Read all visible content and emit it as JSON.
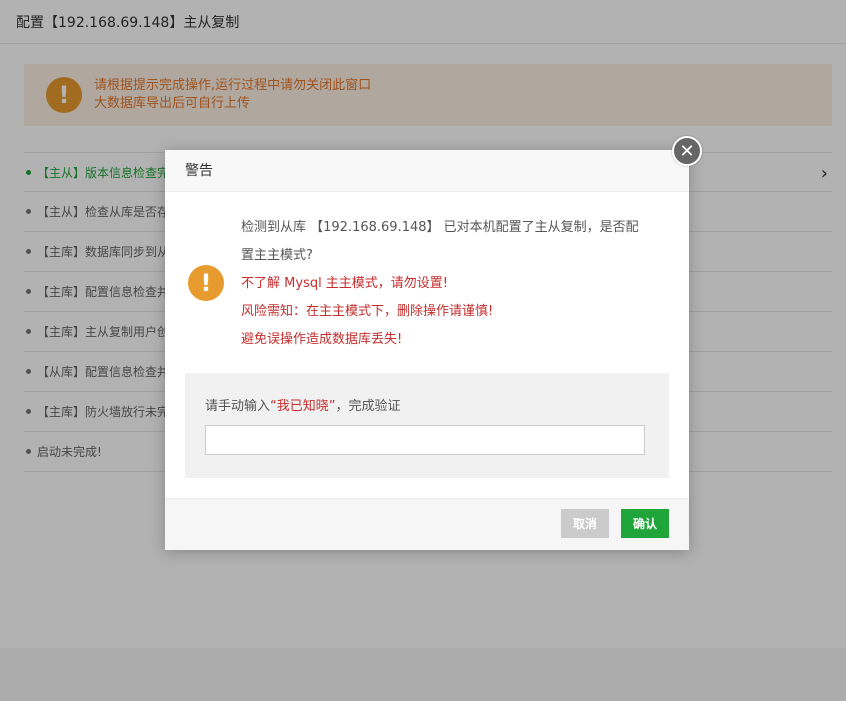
{
  "window": {
    "title": "配置【192.168.69.148】主从复制"
  },
  "notice": {
    "lines": [
      "请根据提示完成操作,运行过程中请勿关闭此窗口",
      "大数据库导出后可自行上传"
    ]
  },
  "steps": [
    {
      "label": "【主从】版本信息检查完",
      "active": true
    },
    {
      "label": "【主从】检查从库是否存"
    },
    {
      "label": "【主库】数据库同步到从"
    },
    {
      "label": "【主库】配置信息检查并"
    },
    {
      "label": "【主库】主从复制用户创"
    },
    {
      "label": "【从库】配置信息检查并"
    },
    {
      "label": "【主库】防火墙放行未完"
    },
    {
      "label": "启动未完成!"
    }
  ],
  "dialog": {
    "title": "警告",
    "message": {
      "line1": "检测到从库 【192.168.69.148】 已对本机配置了主从复制，是否配",
      "line2": "置主主模式?",
      "warn1": "不了解 Mysql 主主模式，请勿设置!",
      "warn2": "风险需知：在主主模式下，删除操作请谨慎!",
      "warn3": "避免误操作造成数据库丢失!"
    },
    "verify": {
      "prefix": "请手动输入",
      "phrase": "“我已知晓”",
      "suffix": "，完成验证",
      "value": "",
      "placeholder": ""
    },
    "cancel_label": "取消",
    "confirm_label": "确认"
  },
  "colors": {
    "accent": "#20a53a",
    "warning": "#e79b2f",
    "danger": "#c52e2e"
  },
  "icons": {
    "close": "close-icon",
    "warning": "warning-icon",
    "chevron": "chevron-right-icon"
  }
}
